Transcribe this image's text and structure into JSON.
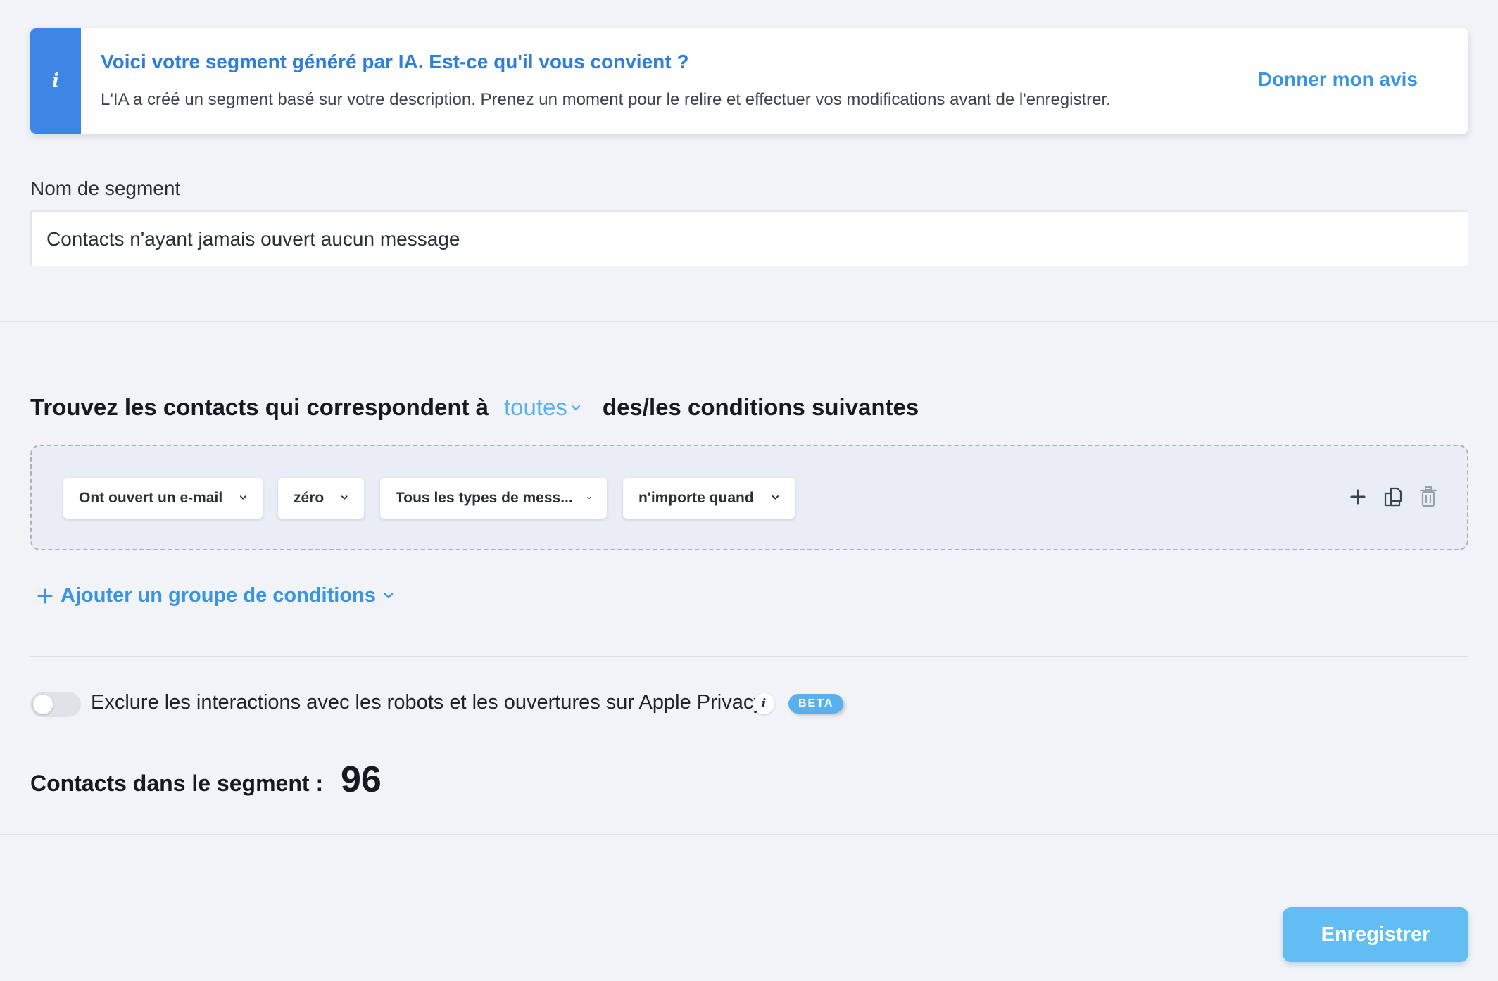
{
  "banner": {
    "title": "Voici votre segment généré par IA. Est-ce qu'il vous convient ?",
    "text": "L'IA a créé un segment basé sur votre description. Prenez un moment pour le relire et effectuer vos modifications avant de l'enregistrer.",
    "feedback_link": "Donner mon avis",
    "icon": "info-icon"
  },
  "segment_name": {
    "label": "Nom de segment",
    "value": "Contacts n'ayant jamais ouvert aucun message"
  },
  "conditions": {
    "heading_prefix": "Trouvez les contacts qui correspondent à",
    "match_mode": "toutes",
    "heading_suffix": "des/les conditions suivantes",
    "row": {
      "action": "Ont ouvert un e-mail",
      "count": "zéro",
      "message_type": "Tous les types de mess...",
      "timeframe": "n'importe quand"
    },
    "row_icons": [
      "plus-icon",
      "duplicate-icon",
      "trash-icon"
    ],
    "add_group_label": "Ajouter un groupe de conditions"
  },
  "bot_filter": {
    "label": "Exclure les interactions avec les robots et les ouvertures sur Apple Privacy",
    "enabled": false,
    "info_glyph": "i",
    "badge": "BETA"
  },
  "summary": {
    "label": "Contacts dans le segment :",
    "count": "96"
  },
  "footer": {
    "save_label": "Enregistrer"
  },
  "colors": {
    "accent": "#3a94e0",
    "banner_stripe": "#3d86e6",
    "save_button": "#62bdf3",
    "background": "#f2f3f7"
  }
}
